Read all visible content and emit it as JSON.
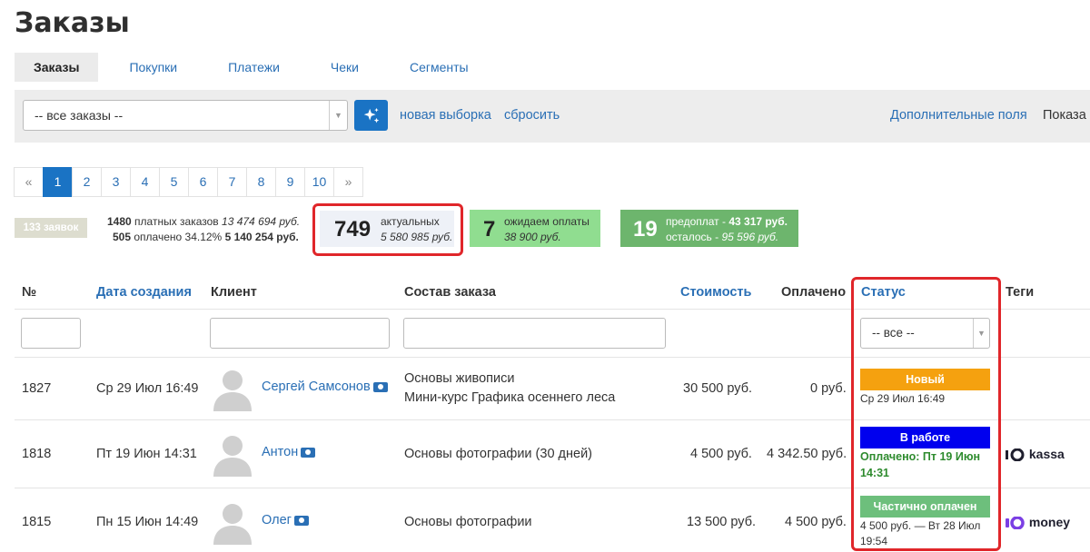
{
  "page_title": "Заказы",
  "tabs": [
    {
      "label": "Заказы",
      "active": true
    },
    {
      "label": "Покупки"
    },
    {
      "label": "Платежи"
    },
    {
      "label": "Чеки"
    },
    {
      "label": "Сегменты"
    }
  ],
  "filter_bar": {
    "select_value": "-- все заказы --",
    "new_selection": "новая выборка",
    "reset": "сбросить",
    "extra_fields": "Дополнительные поля",
    "show": "Показа"
  },
  "pagination": {
    "prev": "«",
    "pages": [
      "1",
      "2",
      "3",
      "4",
      "5",
      "6",
      "7",
      "8",
      "9",
      "10"
    ],
    "current": "1",
    "next": "»"
  },
  "summary": {
    "applications_badge": "133 заявок",
    "paid_orders_count": "1480",
    "paid_orders_label": "платных заказов",
    "paid_orders_sum": "13 474 694 руб.",
    "paid_count": "505",
    "paid_label": "оплачено 34.12%",
    "paid_sum": "5 140 254 руб.",
    "current_count": "749",
    "current_label": "актуальных",
    "current_sum": "5 580 985 руб.",
    "waiting_count": "7",
    "waiting_label": "ожидаем оплаты",
    "waiting_sum": "38 900 руб.",
    "prepay_count": "19",
    "prepay_label": "предоплат -",
    "prepay_sum": "43 317 руб.",
    "remaining_label": "осталось -",
    "remaining_sum": "95 596 руб."
  },
  "table": {
    "headers": {
      "number": "№",
      "created": "Дата создания",
      "client": "Клиент",
      "composition": "Состав заказа",
      "cost": "Стоимость",
      "paid": "Оплачено",
      "status": "Статус",
      "tags": "Теги"
    },
    "status_filter": "-- все --",
    "rows": [
      {
        "id": "1827",
        "date": "Ср 29 Июл 16:49",
        "client": "Сергей Самсонов",
        "items": [
          "Основы живописи",
          "Мини-курс Графика осеннего леса"
        ],
        "cost": "30 500 руб.",
        "paid": "0 руб.",
        "status": "Новый",
        "status_color": "#f5a10f",
        "status_sub": "Ср 29 Июл 16:49"
      },
      {
        "id": "1818",
        "date": "Пт 19 Июн 14:31",
        "client": "Антон",
        "items": [
          "Основы фотографии (30 дней)"
        ],
        "cost": "4 500 руб.",
        "paid": "4 342.50 руб.",
        "status": "В работе",
        "status_color": "#0000ee",
        "status_paid": "Оплачено: Пт 19 Июн 14:31",
        "tag": "kassa"
      },
      {
        "id": "1815",
        "date": "Пн 15 Июн 14:49",
        "client": "Олег",
        "items": [
          "Основы фотографии"
        ],
        "cost": "13 500 руб.",
        "paid": "4 500 руб.",
        "status": "Частично оплачен",
        "status_color": "#6dbf7c",
        "status_sub": "4 500 руб. — Вт 28 Июл 19:54",
        "tag": "money"
      }
    ]
  }
}
